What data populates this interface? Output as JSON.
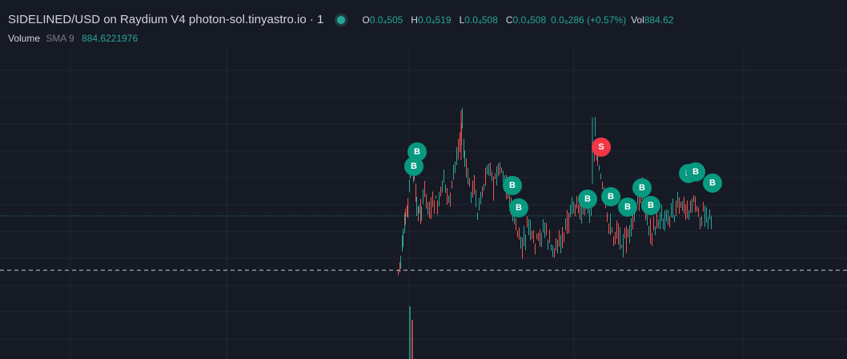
{
  "header": {
    "symbol_title": "SIDELINED/USD on Raydium V4 photon-sol.tinyastro.io · 1",
    "open_label": "O",
    "open_value": "0.0₄505",
    "high_label": "H",
    "high_value": "0.0₄519",
    "low_label": "L",
    "low_value": "0.0₄508",
    "close_label": "C",
    "close_value": "0.0₄508",
    "change_value": "0.0₆286 (+0.57%)",
    "vol_label": "Vol",
    "vol_value": "884.62"
  },
  "volume_indicator": {
    "label": "Volume",
    "params": "SMA 9",
    "value": "884.6221976"
  },
  "colors": {
    "background": "#161a25",
    "up": "#26a69a",
    "down": "#ef5350",
    "buy_marker": "#089981",
    "sell_marker": "#f23645",
    "grid": "#232733"
  },
  "trade_markers": [
    {
      "label": "B",
      "type": "buy"
    },
    {
      "label": "B",
      "type": "buy"
    },
    {
      "label": "B",
      "type": "buy"
    },
    {
      "label": "B",
      "type": "buy"
    },
    {
      "label": "S",
      "type": "sell"
    },
    {
      "label": "B",
      "type": "buy"
    },
    {
      "label": "B",
      "type": "buy"
    },
    {
      "label": "B",
      "type": "buy"
    },
    {
      "label": "B",
      "type": "buy"
    },
    {
      "label": "B",
      "type": "buy"
    },
    {
      "label": "B",
      "type": "buy"
    },
    {
      "label": "B",
      "type": "buy"
    },
    {
      "label": "B",
      "type": "buy"
    }
  ]
}
